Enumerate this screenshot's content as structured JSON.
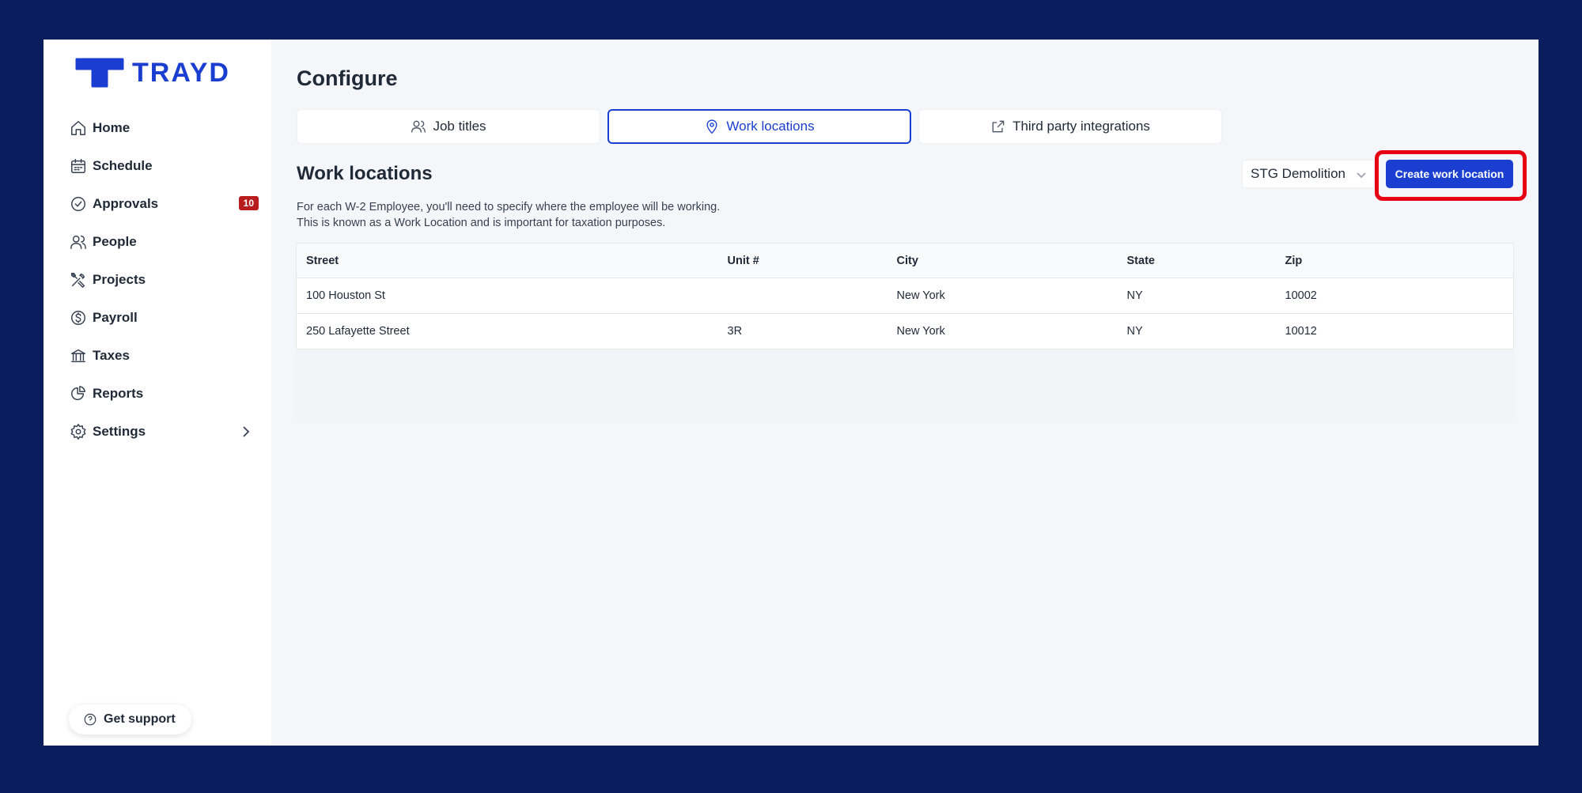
{
  "brand": {
    "name": "TRAYD",
    "color": "#1a3fd0"
  },
  "sidebar": {
    "items": [
      {
        "label": "Home",
        "icon": "home-icon"
      },
      {
        "label": "Schedule",
        "icon": "calendar-icon"
      },
      {
        "label": "Approvals",
        "icon": "check-circle-icon",
        "badge": "10"
      },
      {
        "label": "People",
        "icon": "people-icon"
      },
      {
        "label": "Projects",
        "icon": "tools-icon"
      },
      {
        "label": "Payroll",
        "icon": "dollar-circle-icon"
      },
      {
        "label": "Taxes",
        "icon": "bank-icon"
      },
      {
        "label": "Reports",
        "icon": "pie-chart-icon"
      },
      {
        "label": "Settings",
        "icon": "gear-icon"
      }
    ],
    "support_label": "Get support"
  },
  "main": {
    "page_title": "Configure",
    "tabs": [
      {
        "label": "Job titles",
        "icon": "people-icon"
      },
      {
        "label": "Work locations",
        "icon": "map-pin-icon",
        "active": true
      },
      {
        "label": "Third party integrations",
        "icon": "external-link-icon"
      }
    ],
    "section_title": "Work locations",
    "description_line1": "For each W-2 Employee, you'll need to specify where the employee will be working.",
    "description_line2": "This is known as a Work Location and is important for taxation purposes.",
    "company_select": "STG Demolition",
    "create_button": "Create work location",
    "table": {
      "headers": [
        "Street",
        "Unit #",
        "City",
        "State",
        "Zip"
      ],
      "rows": [
        [
          "100 Houston St",
          "",
          "New York",
          "NY",
          "10002"
        ],
        [
          "250 Lafayette Street",
          "3R",
          "New York",
          "NY",
          "10012"
        ]
      ]
    }
  }
}
